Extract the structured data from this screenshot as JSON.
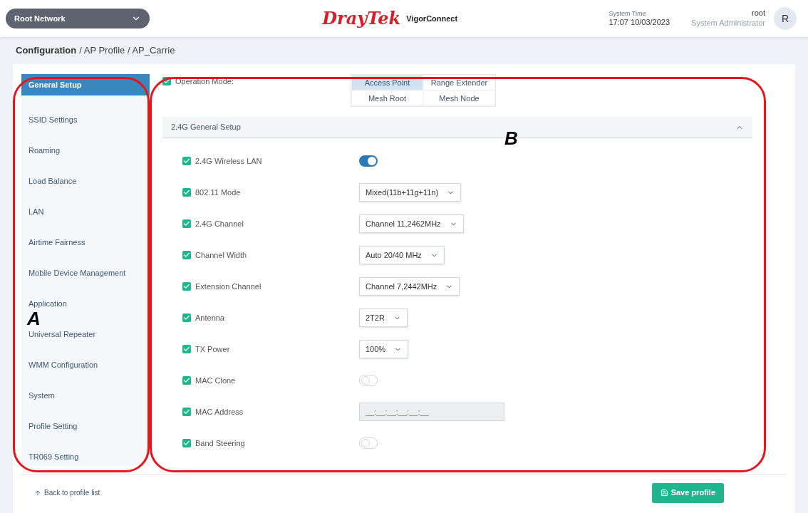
{
  "header": {
    "network": "Root Network",
    "logo_brand": "DrayTek",
    "logo_product": "VigorConnect",
    "time_label": "System Time",
    "time_value": "17:07 10/03/2023",
    "user_name": "root",
    "user_role": "System Administrator",
    "avatar": "R"
  },
  "breadcrumb": {
    "root": "Configuration",
    "path": "/ AP Profile / AP_Carrie"
  },
  "sidebar": {
    "items": [
      {
        "label": "General Setup",
        "selected": true
      },
      {
        "label": "SSID Settings",
        "selected": false
      },
      {
        "label": "Roaming",
        "selected": false
      },
      {
        "label": "Load Balance",
        "selected": false
      },
      {
        "label": "LAN",
        "selected": false
      },
      {
        "label": "Airtime Fairness",
        "selected": false
      },
      {
        "label": "Mobile Device Management",
        "selected": false
      },
      {
        "label": "Application",
        "selected": false
      },
      {
        "label": "Universal Repeater",
        "selected": false
      },
      {
        "label": "WMM Configuration",
        "selected": false
      },
      {
        "label": "System",
        "selected": false
      },
      {
        "label": "Profile Setting",
        "selected": false
      },
      {
        "label": "TR069 Setting",
        "selected": false
      }
    ]
  },
  "operation_mode": {
    "label": "Operation Mode:",
    "checked": true,
    "options": [
      {
        "label": "Access Point",
        "selected": true
      },
      {
        "label": "Range Extender",
        "selected": false
      },
      {
        "label": "Mesh Root",
        "selected": false
      },
      {
        "label": "Mesh Node",
        "selected": false
      }
    ]
  },
  "section": {
    "title": "2.4G General Setup",
    "expanded": true
  },
  "rows": [
    {
      "kind": "toggle",
      "label": "2.4G Wireless LAN",
      "checked": true,
      "on": true
    },
    {
      "kind": "select",
      "label": "802.11 Mode",
      "checked": true,
      "value": "Mixed(11b+11g+11n)"
    },
    {
      "kind": "select",
      "label": "2.4G Channel",
      "checked": true,
      "value": "Channel 11,2462MHz"
    },
    {
      "kind": "select",
      "label": "Channel Width",
      "checked": true,
      "value": "Auto 20/40 MHz"
    },
    {
      "kind": "select",
      "label": "Extension Channel",
      "checked": true,
      "value": "Channel 7,2442MHz"
    },
    {
      "kind": "select",
      "label": "Antenna",
      "checked": true,
      "value": "2T2R"
    },
    {
      "kind": "select",
      "label": "TX Power",
      "checked": true,
      "value": "100%"
    },
    {
      "kind": "toggle",
      "label": "MAC Clone",
      "checked": true,
      "on": false
    },
    {
      "kind": "input",
      "label": "MAC Address",
      "checked": true,
      "placeholder": "__:__:__:__:__:__",
      "disabled": true
    },
    {
      "kind": "toggle",
      "label": "Band Steering",
      "checked": true,
      "on": false
    }
  ],
  "footer": {
    "back": "Back to profile list",
    "save": "Save profile"
  },
  "annotations": [
    {
      "label": "A"
    },
    {
      "label": "B"
    }
  ]
}
